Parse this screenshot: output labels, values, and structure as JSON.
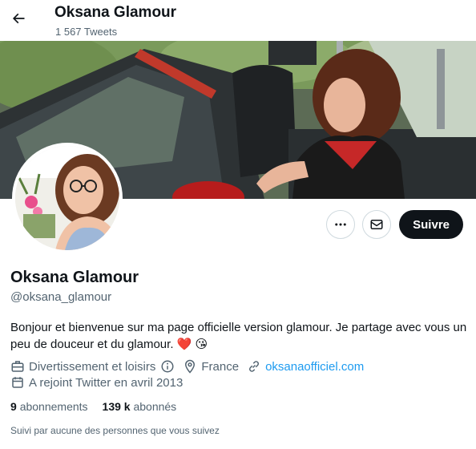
{
  "header": {
    "title": "Oksana Glamour",
    "tweet_count": "1 567 Tweets"
  },
  "actions": {
    "more_icon": "more-horizontal-icon",
    "message_icon": "envelope-icon",
    "follow_label": "Suivre"
  },
  "profile": {
    "name": "Oksana Glamour",
    "handle": "@oksana_glamour",
    "bio": "Bonjour et bienvenue sur ma page officielle version glamour. Je partage avec vous un peu de douceur et du glamour.",
    "bio_emoji_1": "❤️",
    "bio_emoji_2": "😘",
    "category": "Divertissement et loisirs",
    "location": "France",
    "website": "oksanaofficiel.com",
    "joined": "A rejoint Twitter en avril 2013",
    "following_count": "9",
    "following_label": "abonnements",
    "followers_count": "139 k",
    "followers_label": "abonnés",
    "followed_by": "Suivi par aucune des personnes que vous suivez"
  },
  "colors": {
    "accent": "#1d9bf0",
    "text": "#0f1419",
    "muted": "#536471",
    "follow_bg": "#0f1419",
    "heart": "#e0245e"
  }
}
